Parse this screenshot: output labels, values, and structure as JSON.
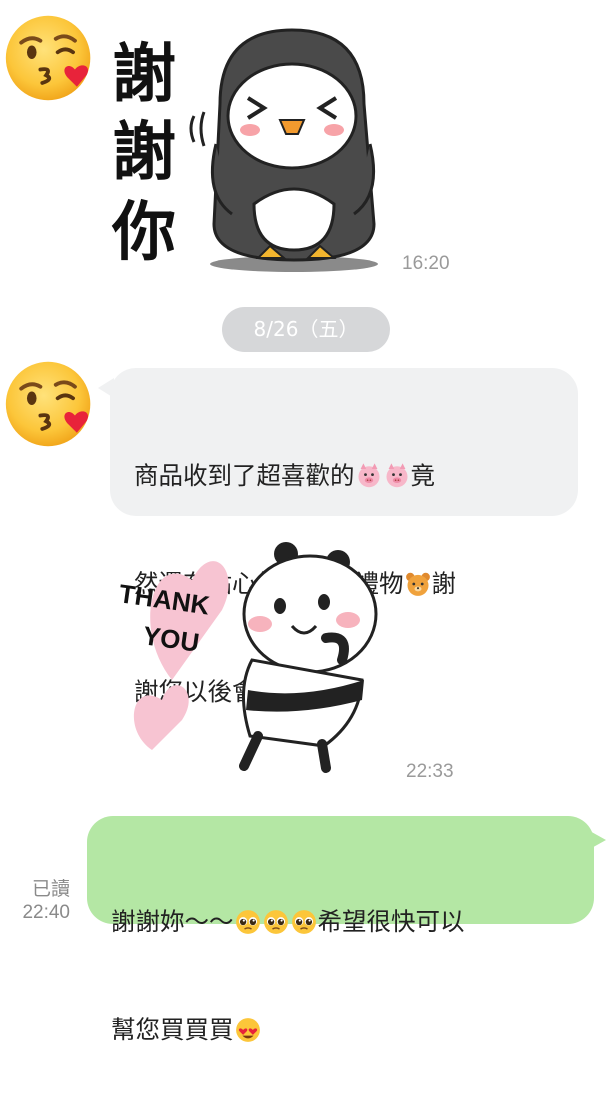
{
  "messages": [
    {
      "type": "sticker",
      "sender": "other",
      "sticker_text": [
        "謝",
        "謝",
        "你"
      ],
      "sticker_icon": "penguin-thanks-sticker",
      "time": "16:20"
    },
    {
      "type": "date_divider",
      "label": "8/26（五）"
    },
    {
      "type": "text",
      "sender": "other",
      "lines": [
        "商品收到了超喜歡的",
        "竟",
        "然還有貼心紙條跟小禮物",
        "謝",
        "謝您以後會常購買的"
      ],
      "emoji": [
        "pig-emoji",
        "pig-emoji",
        "bear-emoji"
      ]
    },
    {
      "type": "sticker",
      "sender": "other",
      "sticker_text": [
        "THANK",
        "YOU"
      ],
      "sticker_icon": "panda-thank-you-sticker",
      "time": "22:33"
    },
    {
      "type": "text",
      "sender": "me",
      "lines": [
        "謝謝妳～～",
        "希望很快可以",
        "幫您買買買"
      ],
      "emoji": [
        "pleading-face-emoji",
        "pleading-face-emoji",
        "pleading-face-emoji",
        "heart-eyes-emoji"
      ],
      "read_label": "已讀",
      "time": "22:40"
    }
  ],
  "avatar_icon": "kissing-face-emoji",
  "colors": {
    "outgoing_bubble": "#b4e7a4",
    "incoming_bubble": "#f0f1f2",
    "date_pill": "#d6d7d9"
  }
}
